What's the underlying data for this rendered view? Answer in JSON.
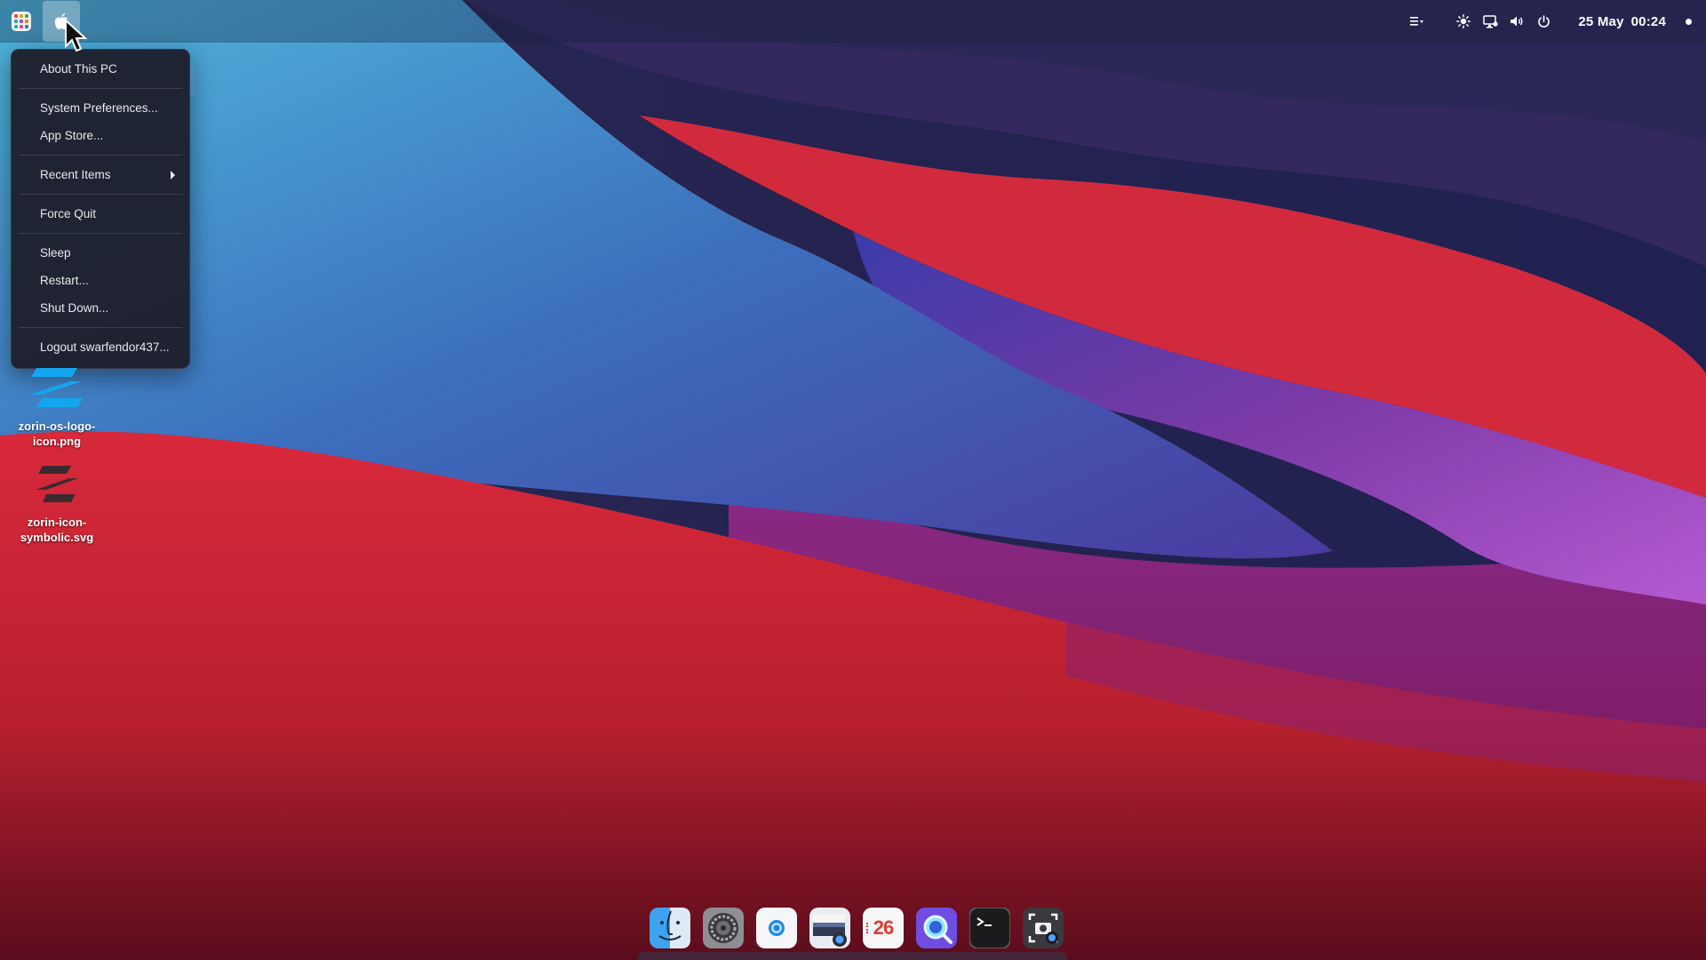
{
  "topbar": {
    "clock": {
      "date": "25 May",
      "time": "00:24"
    },
    "tray_icons": [
      "menu-icon",
      "brightness-icon",
      "display-icon",
      "volume-icon",
      "power-icon"
    ]
  },
  "apple_menu": {
    "about": "About This PC",
    "system_prefs": "System Preferences...",
    "app_store": "App Store...",
    "recent_items": "Recent Items",
    "force_quit": "Force Quit",
    "sleep": "Sleep",
    "restart": "Restart...",
    "shutdown": "Shut Down...",
    "logout": "Logout swarfendor437..."
  },
  "desktop_icons": [
    {
      "label": "zorin-os-logo-icon.png"
    },
    {
      "label": "zorin-icon-symbolic.svg"
    }
  ],
  "dock": {
    "calendar_day": "26",
    "items": [
      "finder-icon",
      "system-settings-icon",
      "browser-icon",
      "screenshot-viewer-icon",
      "calendar-icon",
      "search-icon",
      "terminal-icon",
      "screenshot-icon"
    ]
  },
  "colors": {
    "menu_bg": "#1e202c",
    "topbar_bg": "#161e3a",
    "zorin_blue": "#15a6f0",
    "calendar_red": "#e53935"
  }
}
